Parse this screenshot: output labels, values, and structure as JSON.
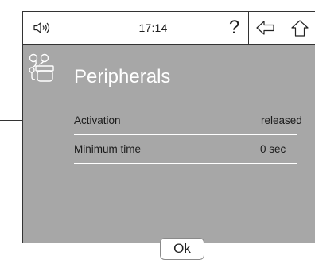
{
  "status_bar": {
    "time": "17:14",
    "help_label": "?",
    "icons": [
      "speaker-icon",
      "back-arrow-icon",
      "home-icon"
    ]
  },
  "screen": {
    "title": "Peripherals",
    "header_icon": "peripherals-icon",
    "rows": [
      {
        "label": "Activation",
        "value": "released"
      },
      {
        "label": "Minimum time",
        "value": "0 sec"
      }
    ],
    "ok_label": "Ok"
  },
  "colors": {
    "screen_background": "#a7a7a7",
    "title_text": "#ffffff",
    "row_text": "#1b1b1b",
    "frame_border": "#333333"
  }
}
